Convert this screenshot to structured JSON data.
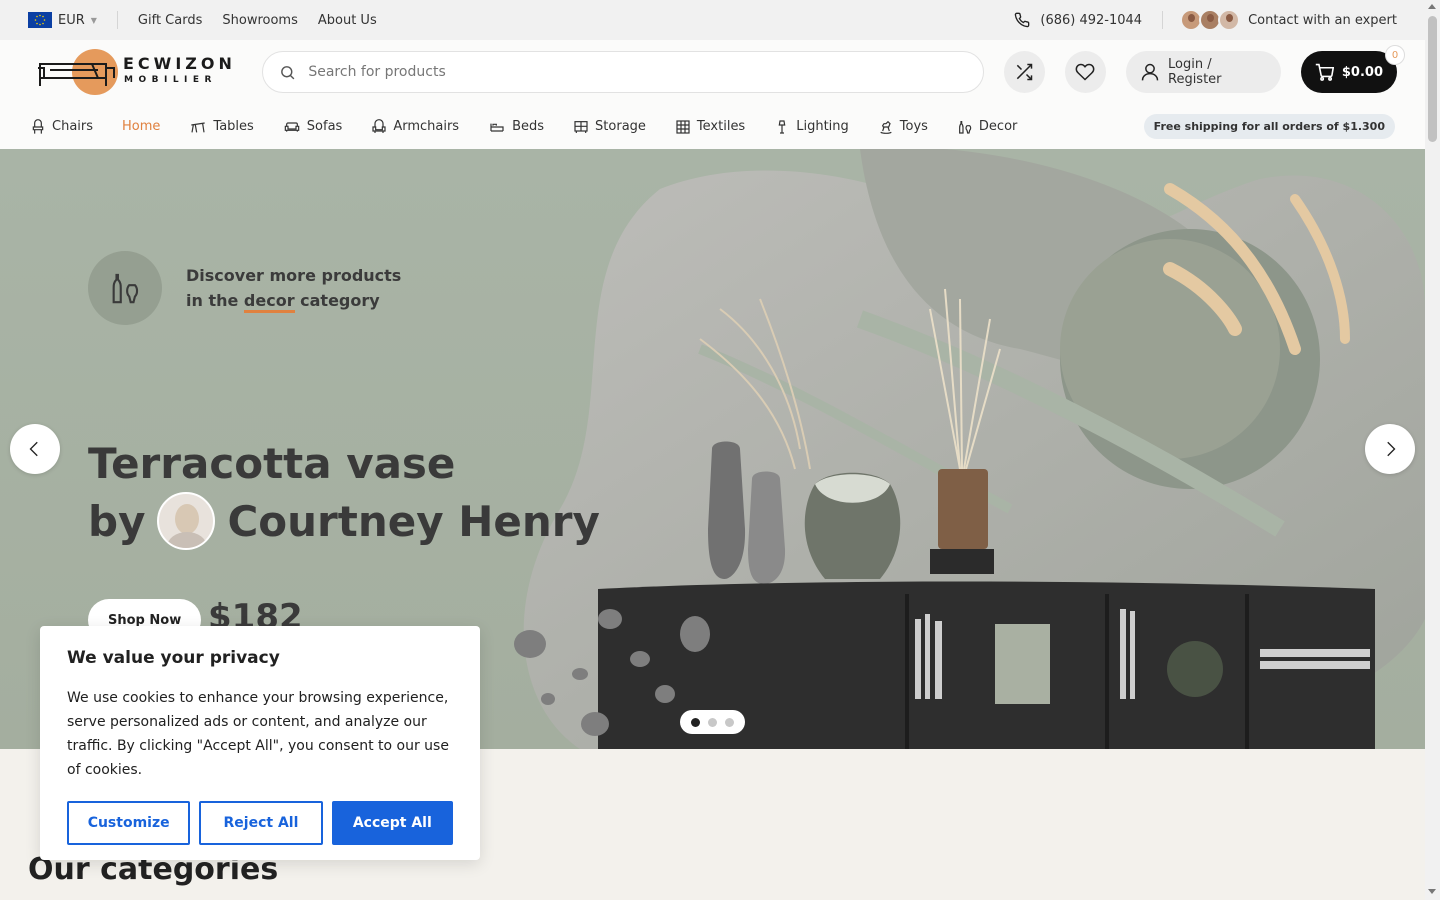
{
  "topbar": {
    "currency": "EUR",
    "links": [
      "Gift Cards",
      "Showrooms",
      "About Us"
    ],
    "phone": "(686) 492-1044",
    "contact": "Contact with an expert"
  },
  "header": {
    "logo_line1": "ECWIZON",
    "logo_line2": "MOBILIER",
    "search_placeholder": "Search for products",
    "login": "Login / Register",
    "cart_total": "$0.00",
    "cart_count": "0"
  },
  "nav": {
    "items": [
      "Chairs",
      "Home",
      "Tables",
      "Sofas",
      "Armchairs",
      "Beds",
      "Storage",
      "Textiles",
      "Lighting",
      "Toys",
      "Decor"
    ],
    "active": "Home",
    "shipping": "Free shipping for all orders of $1.300"
  },
  "hero": {
    "discover_line1": "Discover more products",
    "discover_line2_pre": "in the ",
    "discover_line2_word": "decor",
    "discover_line2_post": " category",
    "title_line1": "Terracotta vase",
    "title_by": "by",
    "title_author": "Courtney Henry",
    "cta": "Shop Now",
    "price": "$182",
    "slide_count": 3,
    "active_slide": 1
  },
  "sections": {
    "categories_title": "Our categories"
  },
  "cookie": {
    "title": "We value your privacy",
    "body": "We use cookies to enhance your browsing experience, serve personalized ads or content, and analyze our traffic. By clicking \"Accept All\", you consent to our use of cookies.",
    "customize": "Customize",
    "reject": "Reject All",
    "accept": "Accept All"
  },
  "colors": {
    "accent": "#e0813f",
    "cookie_blue": "#1863dc",
    "hero_bg": "#a9b3a4"
  }
}
